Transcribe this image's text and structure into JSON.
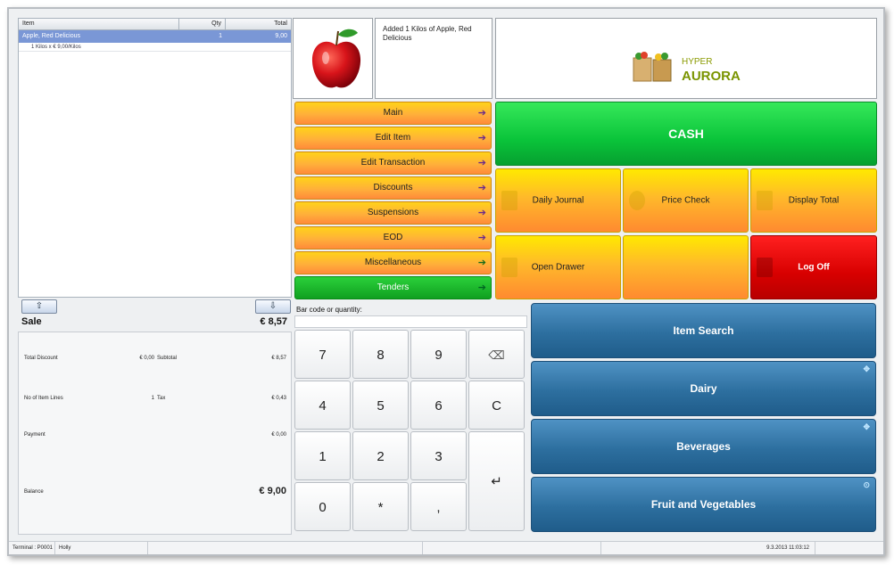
{
  "receipt": {
    "headers": [
      "Item",
      "Qty",
      "Total"
    ],
    "line": {
      "item": "Apple, Red Delicious",
      "qty": "1",
      "total": "9,00",
      "detail": "1 Kilos x € 9,00/Kilos"
    },
    "scroll_up_glyph": "⇧",
    "scroll_down_glyph": "⇩",
    "sale_label": "Sale",
    "sale_total": "€ 8,57"
  },
  "totals": {
    "total_discount_label": "Total Discount",
    "total_discount_value": "€ 0,00",
    "subtotal_label": "Subtotal",
    "subtotal_value": "€ 8,57",
    "item_lines_label": "No of Item Lines",
    "item_lines_value": "1",
    "tax_label": "Tax",
    "tax_value": "€ 0,43",
    "payment_label": "Payment",
    "payment_value": "€ 0,00",
    "balance_label": "Balance",
    "balance_value": "€ 9,00"
  },
  "message": "Added 1 Kilos of Apple, Red Delicious",
  "logo": {
    "line1": "HYPER",
    "line2": "AURORA",
    "icon": "shopping-bags-icon"
  },
  "menu": [
    {
      "label": "Main",
      "arrow": "➔"
    },
    {
      "label": "Edit Item",
      "arrow": "➔"
    },
    {
      "label": "Edit Transaction",
      "arrow": "➔"
    },
    {
      "label": "Discounts",
      "arrow": "➔"
    },
    {
      "label": "Suspensions",
      "arrow": "➔"
    },
    {
      "label": "EOD",
      "arrow": "➔"
    },
    {
      "label": "Miscellaneous",
      "arrow": "➔"
    },
    {
      "label": "Tenders",
      "arrow": "➔"
    }
  ],
  "functions": {
    "cash": "CASH",
    "daily_journal": "Daily Journal",
    "price_check": "Price Check",
    "display_total": "Display Total",
    "open_drawer": "Open Drawer",
    "empty": "",
    "log_off": "Log Off"
  },
  "barcode": {
    "label": "Bar code or quantity:",
    "value": ""
  },
  "keypad": [
    "7",
    "8",
    "9",
    "⌫",
    "4",
    "5",
    "6",
    "C",
    "1",
    "2",
    "3",
    "↵",
    "0",
    "*",
    ","
  ],
  "categories": [
    {
      "label": "Item Search",
      "corner": ""
    },
    {
      "label": "Dairy",
      "corner": "✥"
    },
    {
      "label": "Beverages",
      "corner": "✥"
    },
    {
      "label": "Fruit and Vegetables",
      "corner": "⊙"
    }
  ],
  "status": {
    "terminal": "Terminal : P0001",
    "user": "Holly",
    "datetime": "9.3.2013 11:03:12"
  },
  "colors": {
    "menu_orange": "#ffb03a",
    "cash_green": "#0ac43a",
    "logoff_red": "#d80000",
    "category_blue": "#2d6f9f",
    "selected_row": "#7a97d6"
  }
}
